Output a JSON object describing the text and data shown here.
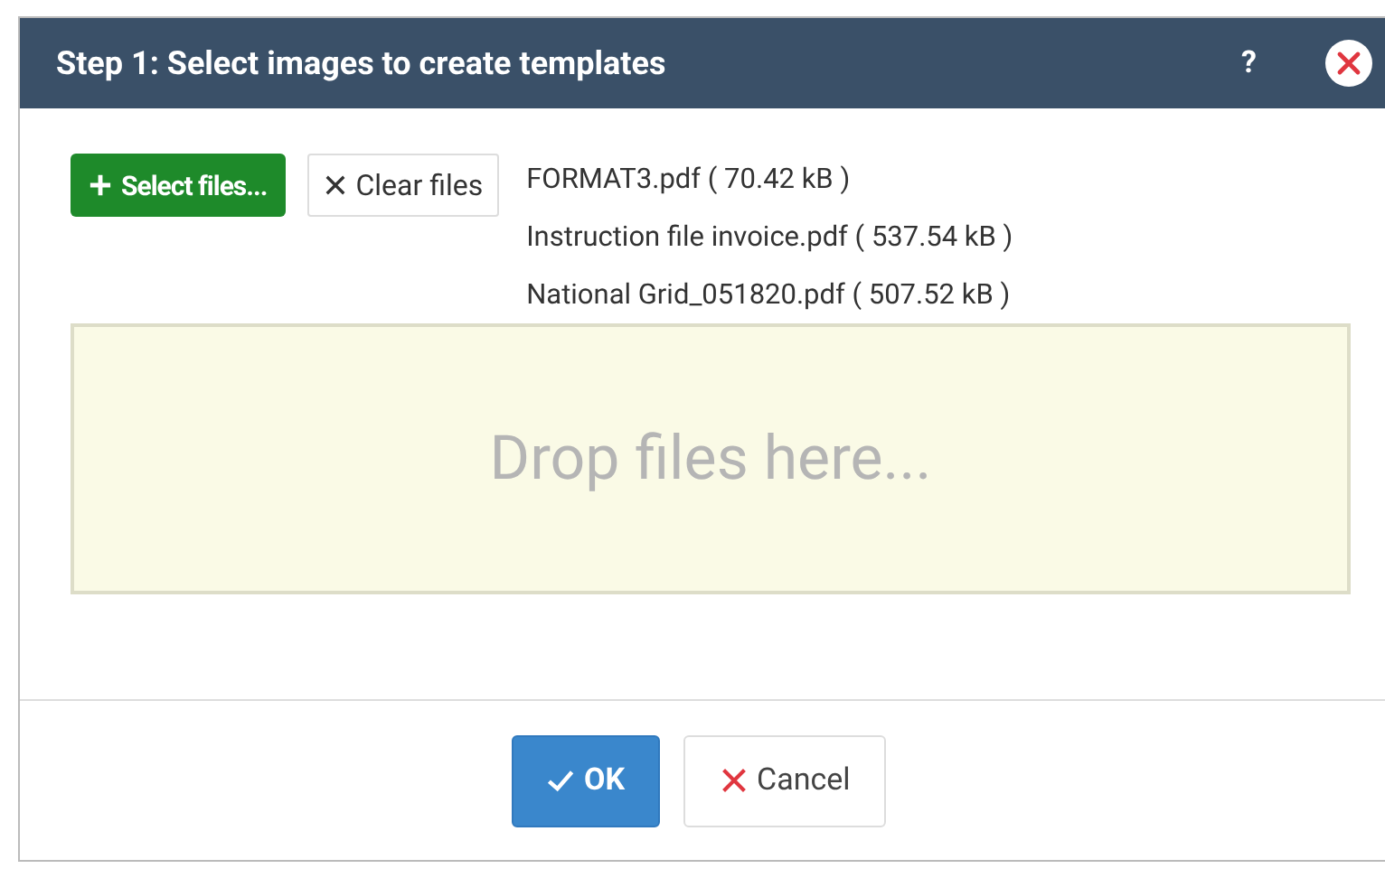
{
  "dialog": {
    "title": "Step 1: Select images to create templates",
    "help": "?"
  },
  "upload": {
    "select_button": "Select files...",
    "clear_button": "Clear files",
    "files": [
      {
        "name": "FORMAT3.pdf ( 70.42 kB )"
      },
      {
        "name": "Instruction file invoice.pdf ( 537.54 kB )"
      },
      {
        "name": "National Grid_051820.pdf ( 507.52 kB )"
      }
    ],
    "drop_zone": "Drop files here..."
  },
  "buttons": [
    {
      "kind": "ok",
      "label": "OK"
    },
    {
      "kind": "cancel",
      "label": "Cancel"
    }
  ]
}
